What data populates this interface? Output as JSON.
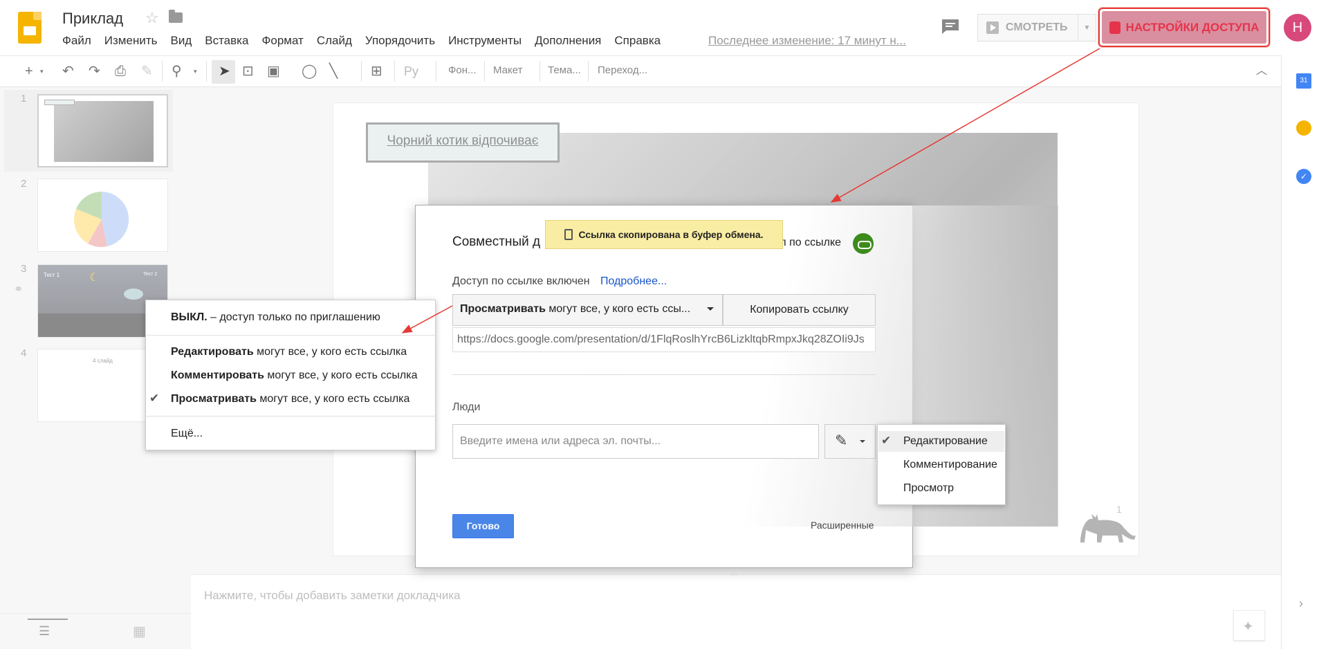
{
  "header": {
    "doc_title": "Приклад",
    "menu": [
      "Файл",
      "Изменить",
      "Вид",
      "Вставка",
      "Формат",
      "Слайд",
      "Упорядочить",
      "Инструменты",
      "Дополнения",
      "Справка"
    ],
    "last_edit": "Последнее изменение: 17 минут н...",
    "present_label": "СМОТРЕТЬ",
    "share_label": "НАСТРОЙКИ ДОСТУПА",
    "avatar_letter": "Н"
  },
  "toolbar": {
    "font_name": "Ру",
    "background_label": "Фон...",
    "layout_label": "Макет",
    "theme_label": "Тема...",
    "transition_label": "Переход..."
  },
  "filmstrip": {
    "slides": [
      {
        "num": "1"
      },
      {
        "num": "2"
      },
      {
        "num": "3"
      },
      {
        "num": "4"
      }
    ],
    "thumb3_text1": "Тест 1",
    "thumb3_text2": "Тест 2",
    "thumb4_title": "4 слайд"
  },
  "slide": {
    "title": "Чорний котик відпочиває",
    "number": "1"
  },
  "notes": {
    "placeholder": "Нажмите, чтобы добавить заметки докладчика"
  },
  "share_dialog": {
    "title": "Совместный д",
    "link_access_label": "уп по ссылке",
    "toast": "Ссылка скопирована в буфер обмена.",
    "link_enabled": "Доступ по ссылке включен",
    "learn_more": "Подробнее...",
    "access_bold": "Просматривать",
    "access_rest": " могут все, у кого есть ссы...",
    "copy_link": "Копировать ссылку",
    "url": "https://docs.google.com/presentation/d/1FlqRoslhYrcB6LizkltqbRmpxJkq28ZOIi9Js",
    "people_label": "Люди",
    "people_placeholder": "Введите имена или адреса эл. почты...",
    "done": "Готово",
    "advanced": "Расширенные"
  },
  "access_menu": {
    "off_bold": "ВЫКЛ.",
    "off_rest": " – доступ только по приглашению",
    "edit_bold": "Редактировать",
    "edit_rest": " могут все, у кого есть ссылка",
    "comment_bold": "Комментировать",
    "comment_rest": " могут все, у кого есть ссылка",
    "view_bold": "Просматривать",
    "view_rest": " могут все, у кого есть ссылка",
    "more": "Ещё..."
  },
  "perm_menu": {
    "items": [
      "Редактирование",
      "Комментирование",
      "Просмотр"
    ]
  },
  "colors": {
    "share_accent": "#e6334b",
    "avatar": "#d8487b",
    "done_button": "#4a86e8",
    "link_icon": "#3c8b1c",
    "toast_bg": "#f9eda4",
    "annotation_arrow": "#e53935"
  }
}
